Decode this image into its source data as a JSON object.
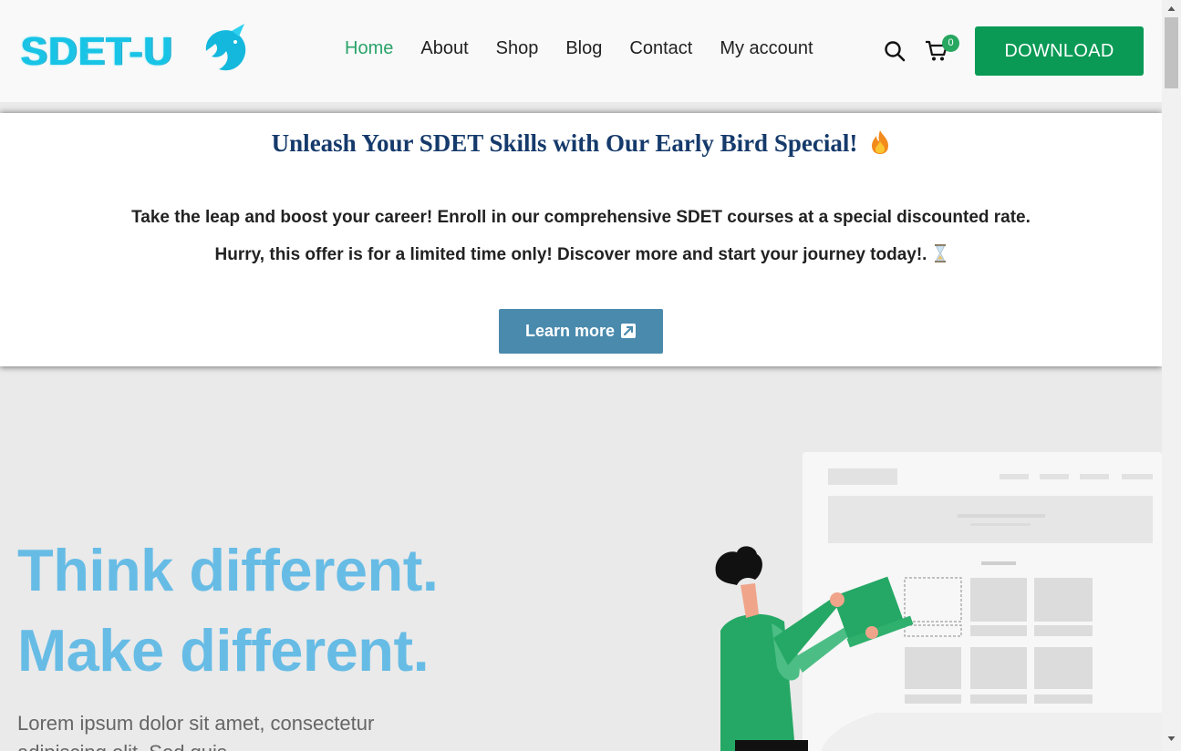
{
  "header": {
    "logo_text": "SDET-U",
    "nav": [
      "Home",
      "About",
      "Shop",
      "Blog",
      "Contact",
      "My account"
    ],
    "active_nav": "Home",
    "cart_count": "0",
    "download_label": "DOWNLOAD"
  },
  "promo": {
    "title": "Unleash Your SDET Skills with Our Early Bird Special!",
    "line1": "Take the leap and boost your career! Enroll in our comprehensive SDET courses at a special discounted rate.",
    "line2": "Hurry, this offer is for a limited time only! Discover more and start your journey today!.",
    "button_label": "Learn more"
  },
  "hero": {
    "heading_line1": "Think different.",
    "heading_line2": "Make different.",
    "text": "Lorem ipsum dolor sit amet, consectetur adipiscing elit. Sed quis"
  },
  "icons": {
    "search": "search-icon",
    "cart": "cart-icon",
    "fire": "fire-icon",
    "hourglass": "hourglass-icon",
    "external": "external-link-icon"
  },
  "colors": {
    "accent_green": "#0a9a55",
    "active_nav": "#2aa36a",
    "promo_title": "#153a6b",
    "learn_button": "#4a8aad",
    "hero_heading": "#67bce5"
  }
}
